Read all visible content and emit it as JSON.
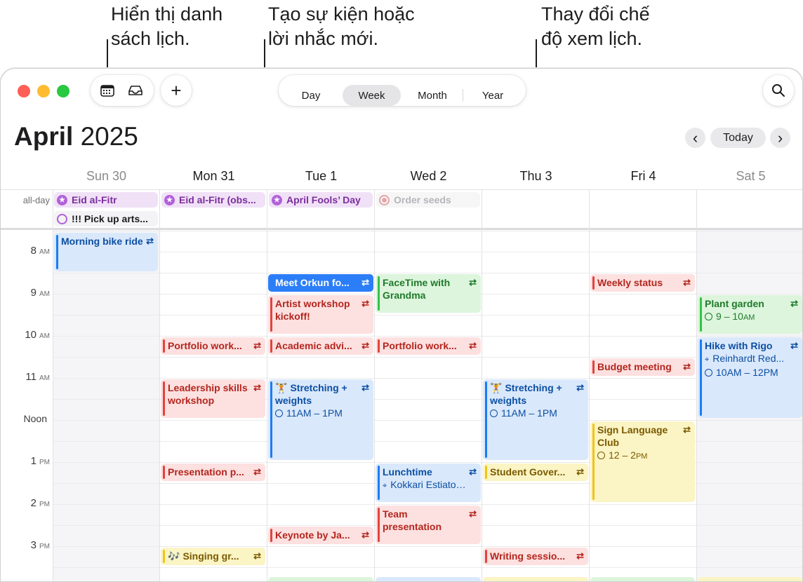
{
  "callouts": {
    "calendars": "Hiển thị danh\nsách lịch.",
    "new_event": "Tạo sự kiện hoặc\nlời nhắc mới.",
    "view": "Thay đổi chế\nđộ xem lịch."
  },
  "toolbar": {
    "add_label": "+",
    "views": [
      "Day",
      "Week",
      "Month",
      "Year"
    ],
    "active_view": "Week"
  },
  "header": {
    "month": "April",
    "year": "2025",
    "today_label": "Today",
    "prev": "‹",
    "next": "›"
  },
  "days": [
    "Sun 30",
    "Mon 31",
    "Tue 1",
    "Wed 2",
    "Thu 3",
    "Fri 4",
    "Sat 5"
  ],
  "allday_label": "all-day",
  "allday_events": [
    {
      "title": "Eid al-Fitr",
      "day": 0
    },
    {
      "title": "!!! Pick up arts...",
      "day": 0
    },
    {
      "title": "Eid al-Fitr (obs...",
      "day": 1
    },
    {
      "title": "April Fools’ Day",
      "day": 2
    },
    {
      "title": "Order seeds",
      "day": 3
    }
  ],
  "hours": [
    {
      "n": "8",
      "ap": "AM"
    },
    {
      "n": "9",
      "ap": "AM"
    },
    {
      "n": "10",
      "ap": "AM"
    },
    {
      "n": "11",
      "ap": "AM"
    },
    {
      "n": "Noon",
      "ap": ""
    },
    {
      "n": "1",
      "ap": "PM"
    },
    {
      "n": "2",
      "ap": "PM"
    },
    {
      "n": "3",
      "ap": "PM"
    }
  ],
  "repeat_icon": "⇄",
  "events": {
    "morning_bike": {
      "title": "Morning bike ride"
    },
    "meet_orkun": {
      "title": "Meet Orkun fo..."
    },
    "artist_workshop": {
      "title": "Artist workshop kickoff!"
    },
    "facetime": {
      "title": "FaceTime with Grandma"
    },
    "weekly_status": {
      "title": "Weekly status"
    },
    "plant_garden": {
      "title": "Plant garden",
      "time": "9 – 10",
      "ap": "AM"
    },
    "portfolio_mon": {
      "title": "Portfolio work..."
    },
    "academic": {
      "title": "Academic advi..."
    },
    "portfolio_wed": {
      "title": "Portfolio work..."
    },
    "hike": {
      "title": "Hike with Rigo",
      "location": "Reinhardt Red...",
      "time": "10AM – 12PM"
    },
    "budget": {
      "title": "Budget meeting"
    },
    "leadership": {
      "title": "Leadership skills workshop"
    },
    "stretch_tue": {
      "emoji": "🏋",
      "title": "Stretching + weights",
      "time": "11AM – 1PM"
    },
    "stretch_thu": {
      "emoji": "🏋",
      "title": "Stretching + weights",
      "time": "11AM – 1PM"
    },
    "sign_language": {
      "title": "Sign Language Club",
      "time": "12 – 2",
      "ap": "PM"
    },
    "presentation": {
      "title": "Presentation p..."
    },
    "lunchtime": {
      "title": "Lunchtime",
      "location": "Kokkari Estiatorio"
    },
    "student_gov": {
      "title": "Student Gover..."
    },
    "team_pres": {
      "title": "Team presentation"
    },
    "keynote": {
      "title": "Keynote by Ja..."
    },
    "singing": {
      "emoji": "🎶",
      "title": "Singing gr..."
    },
    "writing": {
      "title": "Writing sessio..."
    }
  }
}
